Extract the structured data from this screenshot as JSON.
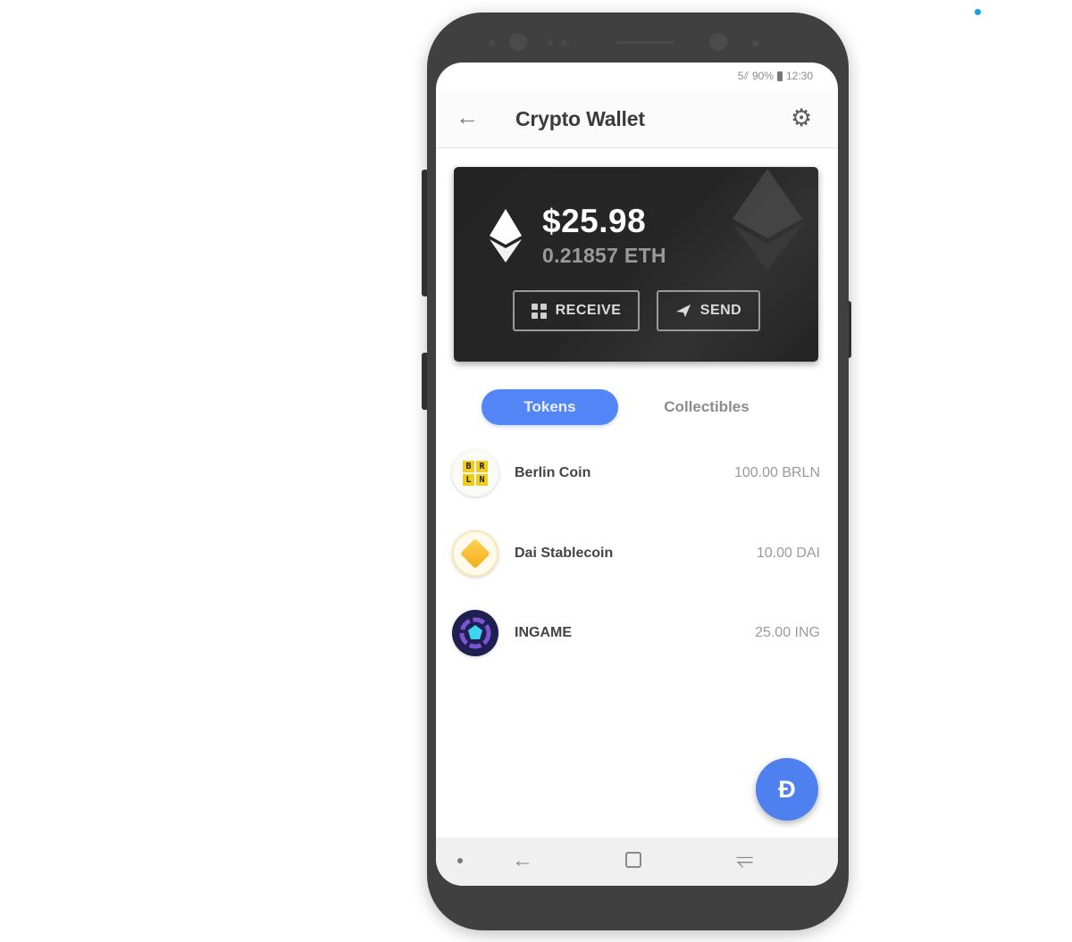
{
  "status_bar": {
    "signal": "5⫽",
    "battery_percent": "90%",
    "time": "12:30"
  },
  "app_bar": {
    "back_icon": "arrow-left-icon",
    "title": "Crypto Wallet",
    "settings_icon": "gear-icon"
  },
  "balance_card": {
    "currency_icon": "ethereum-icon",
    "fiat_balance": "$25.98",
    "crypto_balance": "0.21857 ETH",
    "receive_label": "RECEIVE",
    "receive_icon": "qr-code-icon",
    "send_label": "SEND",
    "send_icon": "paper-plane-icon"
  },
  "tabs": [
    {
      "label": "Tokens",
      "active": true
    },
    {
      "label": "Collectibles",
      "active": false
    }
  ],
  "tokens": [
    {
      "name": "Berlin Coin",
      "amount": "100.00 BRLN",
      "icon": "berlin-coin-icon",
      "icon_letters": [
        "B",
        "R",
        "L",
        "N"
      ]
    },
    {
      "name": "Dai Stablecoin",
      "amount": "10.00 DAI",
      "icon": "dai-icon"
    },
    {
      "name": "INGAME",
      "amount": "25.00 ING",
      "icon": "ingame-icon"
    }
  ],
  "fab": {
    "label": "Ð",
    "icon": "dapp-browser-icon"
  },
  "nav_bar": {
    "back_icon": "nav-back-icon",
    "back_glyph": "←",
    "home_icon": "nav-home-icon",
    "recent_icon": "nav-recent-apps-icon",
    "recent_glyph": "⥫"
  },
  "colors": {
    "accent": "#5385f6",
    "card_background": "#242424",
    "indicator_dot": "#1a9be6"
  }
}
